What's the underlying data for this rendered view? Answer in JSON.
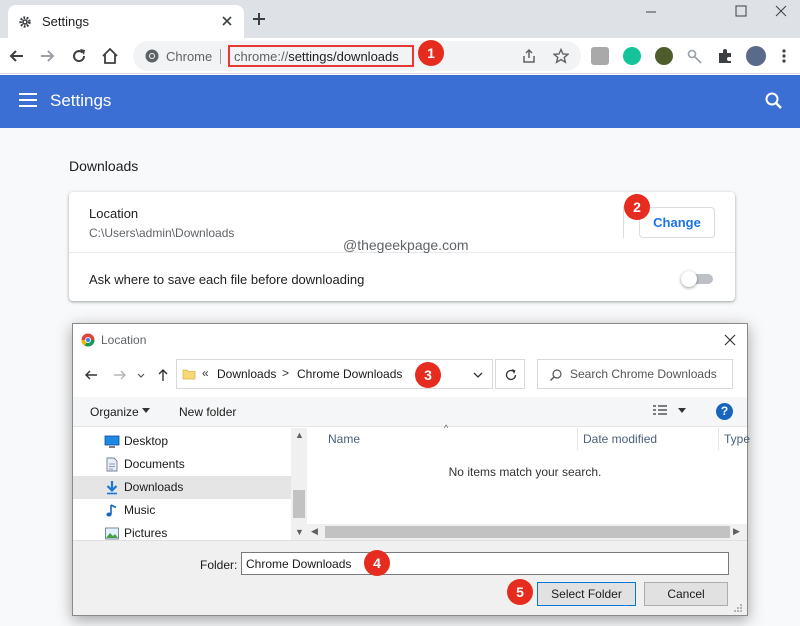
{
  "browser": {
    "tab_title": "Settings",
    "omnibox_site_label": "Chrome",
    "url_scheme": "chrome://",
    "url_path": "settings/downloads"
  },
  "settings": {
    "header_title": "Settings",
    "section_title": "Downloads",
    "location_label": "Location",
    "location_path": "C:\\Users\\admin\\Downloads",
    "change_label": "Change",
    "ask_label": "Ask where to save each file before downloading",
    "ask_enabled": false
  },
  "watermark": "@thegeekpage.com",
  "annotations": [
    "1",
    "2",
    "3",
    "4",
    "5"
  ],
  "dialog": {
    "title": "Location",
    "breadcrumb_prefix": "«",
    "breadcrumb": [
      "Downloads",
      "Chrome Downloads"
    ],
    "breadcrumb_separator": ">",
    "search_placeholder": "Search Chrome Downloads",
    "organize_label": "Organize",
    "new_folder_label": "New folder",
    "help_label": "?",
    "nav_items": [
      {
        "label": "Desktop",
        "icon": "desktop-icon"
      },
      {
        "label": "Documents",
        "icon": "documents-icon"
      },
      {
        "label": "Downloads",
        "icon": "downloads-icon",
        "selected": true
      },
      {
        "label": "Music",
        "icon": "music-icon"
      },
      {
        "label": "Pictures",
        "icon": "pictures-icon"
      }
    ],
    "columns": [
      "Name",
      "Date modified",
      "Type"
    ],
    "empty_message": "No items match your search.",
    "folder_label": "Folder:",
    "folder_value": "Chrome Downloads",
    "select_folder_label": "Select Folder",
    "cancel_label": "Cancel"
  },
  "colors": {
    "settings_header": "#3b6fd4",
    "link_blue": "#1a73e8",
    "annotation_red": "#e52c1e",
    "tab_strip": "#dee1e6"
  }
}
